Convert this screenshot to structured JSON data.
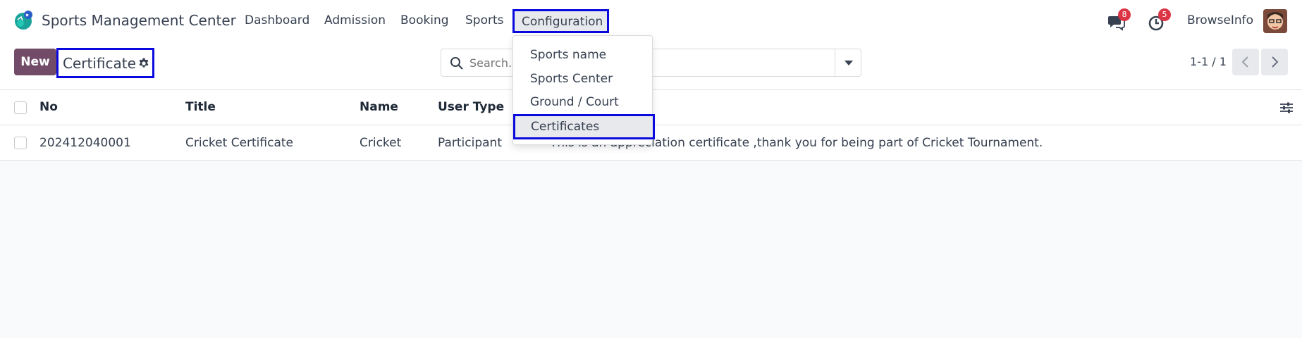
{
  "app": {
    "name": "Sports Management Center",
    "logo_icon": "sports-logo-icon"
  },
  "menu": {
    "items": [
      "Dashboard",
      "Admission",
      "Booking",
      "Sports",
      "Configuration"
    ],
    "active": "Configuration"
  },
  "dropdown": {
    "items": [
      "Sports name",
      "Sports Center",
      "Ground / Court",
      "Certificates"
    ],
    "highlighted": "Certificates"
  },
  "systray": {
    "messages_badge": "8",
    "activities_badge": "5",
    "user_name": "BrowseInfo",
    "messages_icon": "chat-icon",
    "activities_icon": "clock-icon"
  },
  "control_panel": {
    "new_label": "New",
    "breadcrumb": "Certificate",
    "search_placeholder": "Search...",
    "pager_value": "1-1 / 1"
  },
  "table": {
    "columns": [
      "No",
      "Title",
      "Name",
      "User Type"
    ],
    "rows": [
      {
        "no": "202412040001",
        "title": "Cricket Certificate",
        "name": "Cricket",
        "user_type": "Participant",
        "description": "This is an appreciation certificate ,thank you for being part of Cricket Tournament."
      }
    ]
  },
  "colors": {
    "brand": "#714b67",
    "highlight_border": "#0a0adf",
    "badge": "#dc3545"
  }
}
